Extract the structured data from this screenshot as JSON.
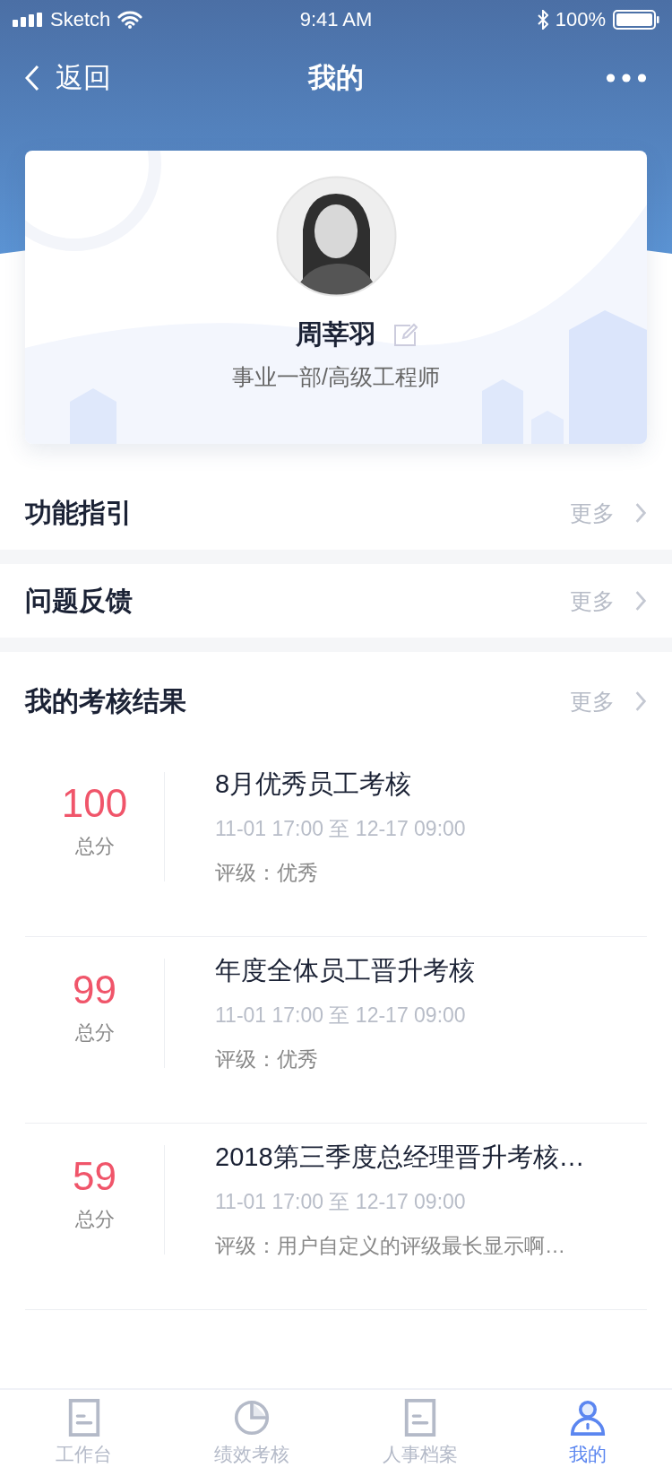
{
  "status_bar": {
    "carrier": "Sketch",
    "time": "9:41 AM",
    "battery": "100%"
  },
  "nav": {
    "back": "返回",
    "title": "我的"
  },
  "profile": {
    "name": "周莘羽",
    "department": "事业一部/高级工程师"
  },
  "menu": [
    {
      "label": "功能指引",
      "more": "更多"
    },
    {
      "label": "问题反馈",
      "more": "更多"
    }
  ],
  "results": {
    "title": "我的考核结果",
    "more": "更多",
    "items": [
      {
        "score": "100",
        "score_label": "总分",
        "name": "8月优秀员工考核",
        "period": "11-01 17:00 至 12-17 09:00",
        "rating": "评级：优秀"
      },
      {
        "score": "99",
        "score_label": "总分",
        "name": "年度全体员工晋升考核",
        "period": "11-01 17:00 至 12-17 09:00",
        "rating": "评级：优秀"
      },
      {
        "score": "59",
        "score_label": "总分",
        "name": "2018第三季度总经理晋升考核…",
        "period": "11-01 17:00 至 12-17 09:00",
        "rating": "评级：用户自定义的评级最长显示啊…"
      }
    ]
  },
  "tabs": [
    {
      "label": "工作台",
      "kind": "doc",
      "selected": false
    },
    {
      "label": "绩效考核",
      "kind": "pie",
      "selected": false
    },
    {
      "label": "人事档案",
      "kind": "doc",
      "selected": false
    },
    {
      "label": "我的",
      "kind": "person",
      "selected": true
    }
  ]
}
